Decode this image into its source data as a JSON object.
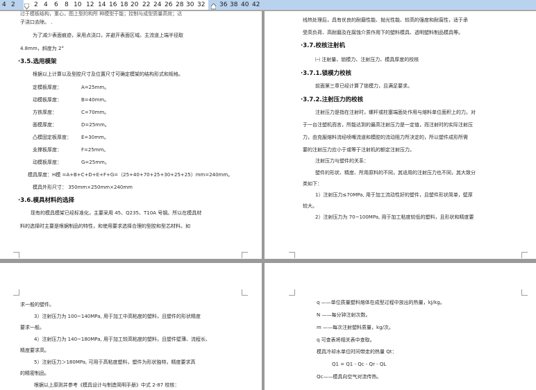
{
  "ruler": {
    "left_numbers": [
      "4",
      "2"
    ],
    "numbers": [
      "2",
      "4",
      "6",
      "8",
      "10",
      "12",
      "14",
      "16",
      "18",
      "20",
      "22",
      "24",
      "26",
      "28",
      "30",
      "32",
      "36",
      "38",
      "40",
      "42"
    ]
  },
  "page1": {
    "lines": [
      "过于模板结构，重心，图上型的构所 种模型于能；控制与成型质量高效；达",
      "子浇口去除。 .",
      "为了减少表面痕迹，采用点浇口，并避开表面区域。主流道上端半径取",
      "4.8mm，斜度为 2°"
    ],
    "section_35": "3.5.选用模架",
    "p35_intro": "根据以上计算以及型腔尺寸及位置尺寸可确定模架的结构形式和规格。",
    "plates": [
      {
        "label": "定模板厚度：",
        "value": "A=25mm。"
      },
      {
        "label": "动模板厚度：",
        "value": "B=40mm。"
      },
      {
        "label": "方铁厚度：",
        "value": "C=70mm。"
      },
      {
        "label": "面模厚度：",
        "value": "D=25mm。"
      },
      {
        "label": "凸模固定板厚度：",
        "value": "E=30mm。"
      },
      {
        "label": "支撑板厚度：",
        "value": "F=25mm。"
      },
      {
        "label": "动模板厚度：",
        "value": "G=25mm。"
      }
    ],
    "mold_thickness": "模具厚度：H模 =A+B+C+D+E+F+G=（25+40+70+25+30+25+25）mm=240mm。",
    "mold_size": "模具外形尺寸：  350mm×250mm×240mm",
    "section_36": "3.6.模具材料的选择",
    "p36_lines": [
      "现有的模具模架已经标准化，主要采用 45、Q235、T10A 号钢。所以在模具材",
      "料的选择时主要是根据制品的特性，和使用要求选择合理的型腔和型芯材料。如"
    ]
  },
  "page2": {
    "top_lines": [
      "线热处理后，具有优良的耐磨性能、抛光性能、较高的强度和耐腐性，适于承",
      "受高负荷、高耐磨及在腐蚀介质作用下的塑料模具、透明塑料制品模具等。"
    ],
    "section_37": "3.7.校核注射机",
    "p37": "㈠ 注射量、锁模力、注射压力、模具厚度的校核",
    "section_371": "3.7.1.锁模力校核",
    "p371": "前面第三章已经计算了锁模力，且满足要求。",
    "section_372": "3.7.2.注射压力的校核",
    "p372_lines": [
      "注射压力是指在注射时，螺杆或柱塞端面处作用与熔料单位面积上的力。对",
      "于一台注塑机而言，所能达到的最高注射压力是一定值，而注射时的实际注射压",
      "力，由克服熔料流经喷嘴流道和模腔的流动阻力所决定的，所以塑件成形所需",
      "要的注射压力应小于或等于注射机的额定注射压力。",
      "注射压力与塑件的关系：",
      "塑件的形状、精度、所用原料的不同，其适用的注射压力也不同，其大致分",
      "类如下：",
      "1）注射压力≤70MPa, 用于加工流动性好的塑件，且塑件形状简单，壁厚",
      "较大。",
      "2）注射压力为 70~100MPa, 用于加工粘度较低的塑料，且形状和精度要"
    ]
  },
  "page3": {
    "lines": [
      "求一般的塑件。",
      "3）注射压力为 100~140MPa, 用于加工中高粘度的塑料，且塑件的形状精度",
      "要求一般。",
      "4）注射压力为 140~180MPa, 用于加工较高粘度的塑料，且塑件壁薄、流程长、",
      "精度要求高。",
      "5）注射压力＞180MPa, 可用于高粘度塑料，塑件为形状独特，精度要求高",
      "的精密制品。",
      "根据以上原则并参考《模具设计与制造简明手册》中式 2-87 校核："
    ]
  },
  "page4": {
    "lines": [
      "q ——单位质量塑料熔体在成型过程中放出的热量，kJ/kg。",
      "N ——每分钟注射次数。",
      "m ——每次注射塑料质量，kg/次。",
      "q 可查表将相关表中查取。",
      "模具冷却水单位时间带走的热量 Qt：",
      "Q1 = Q1 - Qc - Qr - QL",
      "Qc——模具向空气对流传热。"
    ]
  }
}
